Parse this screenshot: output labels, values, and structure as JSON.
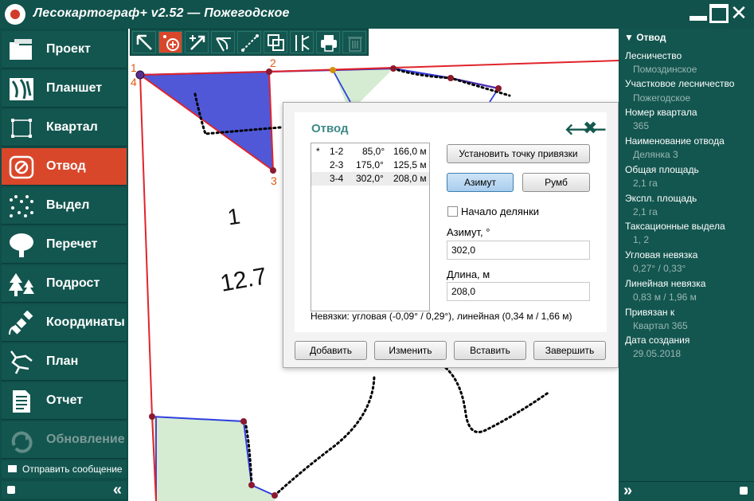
{
  "window": {
    "title": "Лесокартограф+ v2.52 — Пожегодское",
    "logo_icon": "app-logo-icon",
    "controls": [
      "minimize-icon",
      "maximize-icon",
      "close-icon"
    ]
  },
  "sidebar": {
    "items": [
      {
        "label": "Проект",
        "icon": "project-icon",
        "state": "normal"
      },
      {
        "label": "Планшет",
        "icon": "tablet-map-icon",
        "state": "normal"
      },
      {
        "label": "Квартал",
        "icon": "quarter-icon",
        "state": "normal"
      },
      {
        "label": "Отвод",
        "icon": "allotment-icon",
        "state": "active"
      },
      {
        "label": "Выдел",
        "icon": "compartment-icon",
        "state": "normal"
      },
      {
        "label": "Перечет",
        "icon": "tree-count-icon",
        "state": "normal"
      },
      {
        "label": "Подрост",
        "icon": "undergrowth-icon",
        "state": "normal"
      },
      {
        "label": "Координаты",
        "icon": "satellite-icon",
        "state": "normal"
      },
      {
        "label": "План",
        "icon": "plan-icon",
        "state": "normal"
      },
      {
        "label": "Отчет",
        "icon": "report-icon",
        "state": "normal"
      },
      {
        "label": "Обновление",
        "icon": "update-icon",
        "state": "disabled"
      }
    ],
    "send_message": "Отправить сообщение",
    "collapse_icon": "double-chevron-left-icon"
  },
  "toolbar": {
    "tools": [
      "select-arrow-icon",
      "add-point-icon",
      "add-line-icon",
      "arc-icon",
      "measure-icon",
      "copy-icon",
      "split-icon",
      "print-icon",
      "delete-icon"
    ],
    "active_index": 1,
    "disabled_index": 8
  },
  "map": {
    "point_labels": [
      "1",
      "2",
      "3",
      "4"
    ],
    "compartment_number": "1",
    "area_label": "12.7",
    "colors": {
      "allotment_fill": "#5058d8",
      "boundary": "#e0242b",
      "quarter_line": "#3333cc",
      "vydel_fill": "#d5ecd2",
      "vertex": "#8b1a2e"
    }
  },
  "dialog": {
    "title": "Отвод",
    "back_icon": "arrow-left-icon",
    "close_icon": "close-icon",
    "segments": [
      {
        "marker": "*",
        "name": "1-2",
        "angle": "85,0°",
        "length": "166,0 м",
        "selected": false
      },
      {
        "marker": "",
        "name": "2-3",
        "angle": "175,0°",
        "length": "125,5 м",
        "selected": false
      },
      {
        "marker": "",
        "name": "3-4",
        "angle": "302,0°",
        "length": "208,0 м",
        "selected": true
      }
    ],
    "set_anchor_button": "Установить точку привязки",
    "azimuth_button": "Азимут",
    "rhumb_button": "Румб",
    "start_checkbox_label": "Начало делянки",
    "start_checked": false,
    "azimuth_label": "Азимут, °",
    "azimuth_value": "302,0",
    "length_label": "Длина, м",
    "length_value": "208,0",
    "misclosure": "Невязки: угловая (-0,09° / 0,29°), линейная (0,34 м / 1,66 м)",
    "buttons": {
      "add": "Добавить",
      "change": "Изменить",
      "insert": "Вставить",
      "finish": "Завершить"
    }
  },
  "panel": {
    "header": "▼ Отвод",
    "fields": [
      {
        "label": "Лесничество",
        "value": "Помоздинское"
      },
      {
        "label": "Участковое лесничество",
        "value": "Пожегодское"
      },
      {
        "label": "Номер квартала",
        "value": "365"
      },
      {
        "label": "Наименование отвода",
        "value": "Делянка 3"
      },
      {
        "label": "Общая площадь",
        "value": "2,1 га"
      },
      {
        "label": "Экспл. площадь",
        "value": "2,1 га"
      },
      {
        "label": "Таксационные выдела",
        "value": "1, 2"
      },
      {
        "label": "Угловая невязка",
        "value": "0,27° / 0,33°"
      },
      {
        "label": "Линейная невязка",
        "value": "0,83 м / 1,96 м"
      },
      {
        "label": "Привязан к",
        "value": "Квартал 365"
      },
      {
        "label": "Дата создания",
        "value": "29.05.2018"
      }
    ],
    "expand_icon": "double-chevron-right-icon"
  }
}
